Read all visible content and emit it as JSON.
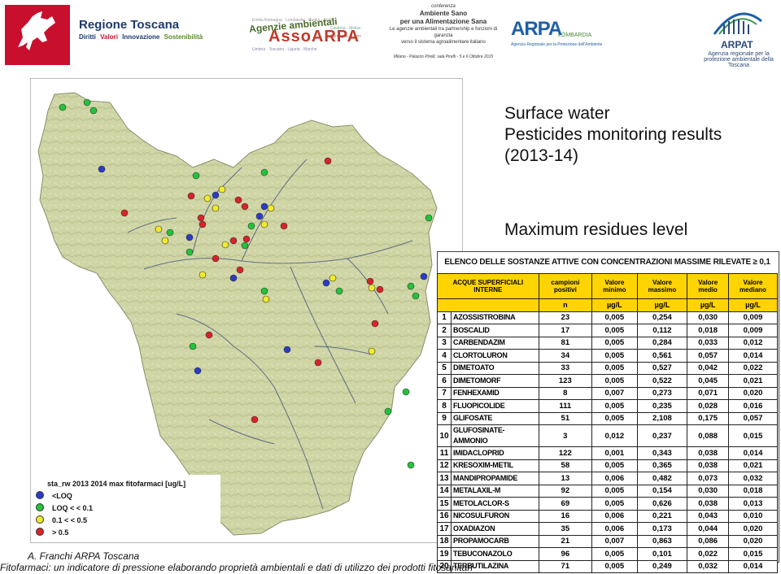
{
  "header": {
    "toscana": {
      "name": "Regione Toscana",
      "sub": [
        "Diritti",
        "Valori",
        "Innovazione",
        "Sostenibilità"
      ]
    },
    "assoarpa": {
      "top": "Agenzie ambientali",
      "big": "AssoARPA"
    },
    "conference": {
      "l1": "conferenza",
      "l2": "Ambiente Sano",
      "l3": "per una Alimentazione Sana",
      "l4": "Le agenzie ambientali tra partnership e funzioni di garanzia",
      "l5": "verso il sistema agroalimentare italiano",
      "l6": "Milano - Palazzo Pirelli, sala Pirelli - 5 e 6 Ottobre 2015"
    },
    "arpa_lombardia": {
      "logo": "ARPA",
      "region": "LOMBARDIA",
      "sub": "Agenzia Regionale per la Protezione dell'Ambiente"
    },
    "arpat": {
      "name": "ARPAT",
      "sub": "Agenzia regionale per la protezione ambientale della Toscana"
    }
  },
  "title": {
    "l1": "Surface water",
    "l2": "Pesticides monitoring results",
    "l3": "(2013-14)",
    "subtitle": "Maximum residues level"
  },
  "legend": {
    "title": "sta_rw 2013 2014  max fitofarmaci [ug/L]",
    "items": [
      {
        "label": "<LOQ",
        "color": "#2a3bc8"
      },
      {
        "label": "LOQ <  < 0.1",
        "color": "#22c33a"
      },
      {
        "label": "0.1 <  < 0.5",
        "color": "#f3ea2a"
      },
      {
        "label": "> 0.5",
        "color": "#d8222a"
      }
    ]
  },
  "table": {
    "title": "ELENCO DELLE SOSTANZE ATTIVE CON CONCENTRAZIONI MASSIME RILEVATE ≥ 0,1 µg/l",
    "header_main": "ACQUE SUPERFICIALI INTERNE",
    "columns": [
      "campioni positivi",
      "Valore minimo",
      "Valore massimo",
      "Valore medio",
      "Valore mediano"
    ],
    "units": [
      "n",
      "µg/L",
      "µg/L",
      "µg/L",
      "µg/L"
    ],
    "rows": [
      {
        "n": "1",
        "name": "AZOSSISTROBINA",
        "c": "23",
        "min": "0,005",
        "max": "0,254",
        "mean": "0,030",
        "med": "0,009"
      },
      {
        "n": "2",
        "name": "BOSCALID",
        "c": "17",
        "min": "0,005",
        "max": "0,112",
        "mean": "0,018",
        "med": "0,009"
      },
      {
        "n": "3",
        "name": "CARBENDAZIM",
        "c": "81",
        "min": "0,005",
        "max": "0,284",
        "mean": "0,033",
        "med": "0,012"
      },
      {
        "n": "4",
        "name": "CLORTOLURON",
        "c": "34",
        "min": "0,005",
        "max": "0,561",
        "mean": "0,057",
        "med": "0,014"
      },
      {
        "n": "5",
        "name": "DIMETOATO",
        "c": "33",
        "min": "0,005",
        "max": "0,527",
        "mean": "0,042",
        "med": "0,022"
      },
      {
        "n": "6",
        "name": "DIMETOMORF",
        "c": "123",
        "min": "0,005",
        "max": "0,522",
        "mean": "0,045",
        "med": "0,021"
      },
      {
        "n": "7",
        "name": "FENHEXAMID",
        "c": "8",
        "min": "0,007",
        "max": "0,273",
        "mean": "0,071",
        "med": "0,020"
      },
      {
        "n": "8",
        "name": "FLUOPICOLIDE",
        "c": "111",
        "min": "0,005",
        "max": "0,235",
        "mean": "0,028",
        "med": "0,016"
      },
      {
        "n": "9",
        "name": "GLIFOSATE",
        "c": "51",
        "min": "0,005",
        "max": "2,108",
        "mean": "0,175",
        "med": "0,057"
      },
      {
        "n": "10",
        "name": "GLUFOSINATE-AMMONIO",
        "c": "3",
        "min": "0,012",
        "max": "0,237",
        "mean": "0,088",
        "med": "0,015"
      },
      {
        "n": "11",
        "name": "IMIDACLOPRID",
        "c": "122",
        "min": "0,001",
        "max": "0,343",
        "mean": "0,038",
        "med": "0,014"
      },
      {
        "n": "12",
        "name": "KRESOXIM-METIL",
        "c": "58",
        "min": "0,005",
        "max": "0,365",
        "mean": "0,038",
        "med": "0,021"
      },
      {
        "n": "13",
        "name": "MANDIPROPAMIDE",
        "c": "13",
        "min": "0,006",
        "max": "0,482",
        "mean": "0,073",
        "med": "0,032"
      },
      {
        "n": "14",
        "name": "METALAXIL-M",
        "c": "92",
        "min": "0,005",
        "max": "0,154",
        "mean": "0,030",
        "med": "0,018"
      },
      {
        "n": "15",
        "name": "METOLACLOR-S",
        "c": "69",
        "min": "0,005",
        "max": "0,626",
        "mean": "0,038",
        "med": "0,013"
      },
      {
        "n": "16",
        "name": "NICOSULFURON",
        "c": "16",
        "min": "0,006",
        "max": "0,221",
        "mean": "0,043",
        "med": "0,010"
      },
      {
        "n": "17",
        "name": "OXADIAZON",
        "c": "35",
        "min": "0,006",
        "max": "0,173",
        "mean": "0,044",
        "med": "0,020"
      },
      {
        "n": "18",
        "name": "PROPAMOCARB",
        "c": "21",
        "min": "0,007",
        "max": "0,863",
        "mean": "0,086",
        "med": "0,020"
      },
      {
        "n": "19",
        "name": "TEBUCONAZOLO",
        "c": "96",
        "min": "0,005",
        "max": "0,101",
        "mean": "0,022",
        "med": "0,015"
      },
      {
        "n": "20",
        "name": "TERBUTILAZINA",
        "c": "71",
        "min": "0,005",
        "max": "0,249",
        "mean": "0,032",
        "med": "0,014"
      }
    ]
  },
  "credits": {
    "author": "A. Franchi  ARPA Toscana",
    "line": "Fitofarmaci: un  indicatore  di  pressione  elaborando  proprietà    ambientali    e  dati  di  utilizzo dei prodotti fitosanitari"
  },
  "colors": {
    "table_header": "#ffd400",
    "map_land": "#cfd5a5",
    "title_text": "#111111"
  }
}
